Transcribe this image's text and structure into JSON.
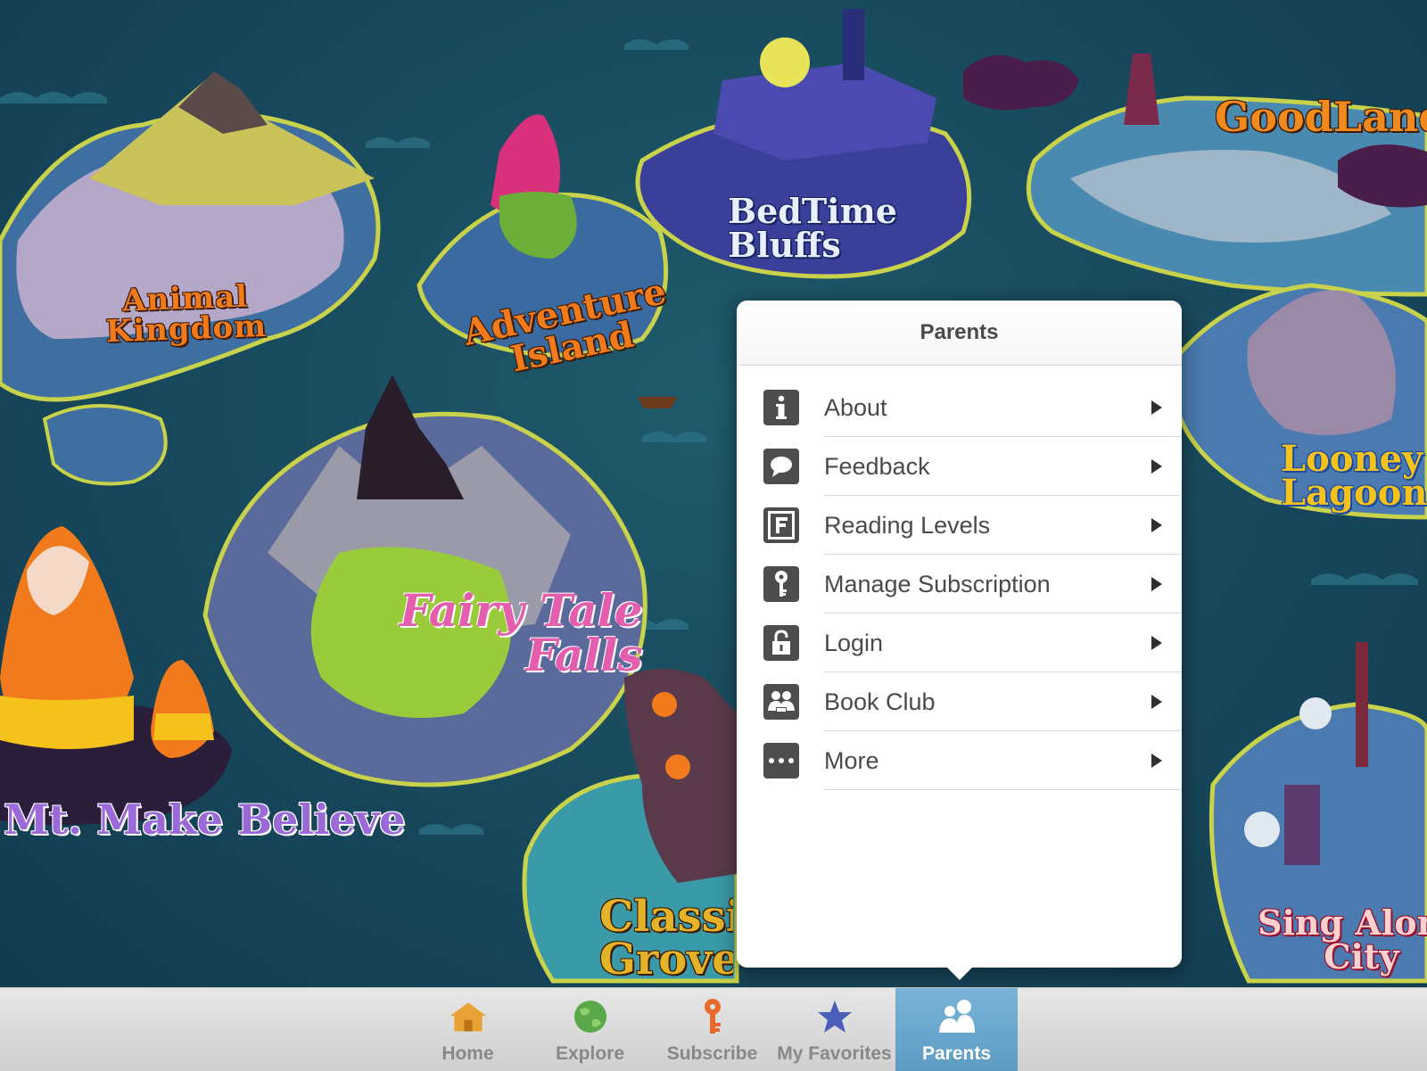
{
  "map": {
    "regions": {
      "animal_kingdom": "Animal\nKingdom",
      "adventure_island": "Adventure\nIsland",
      "bedtime_bluffs": "BedTime\nBluffs",
      "goodland": "GoodLand",
      "looney_lagoon": "Looney\nLagoon",
      "fairy_tale_falls": "Fairy Tale\nFalls",
      "mt_make_believe": "Mt. Make Believe",
      "classic_grove": "Classic\nGrove",
      "sing_along_city": "Sing Along\nCity"
    }
  },
  "popover": {
    "title": "Parents",
    "items": [
      {
        "label": "About",
        "icon": "info-icon"
      },
      {
        "label": "Feedback",
        "icon": "speech-bubble-icon"
      },
      {
        "label": "Reading Levels",
        "icon": "letter-f-icon"
      },
      {
        "label": "Manage Subscription",
        "icon": "key-icon"
      },
      {
        "label": "Login",
        "icon": "unlock-icon"
      },
      {
        "label": "Book Club",
        "icon": "group-icon"
      },
      {
        "label": "More",
        "icon": "more-dots-icon"
      }
    ]
  },
  "tabbar": {
    "tabs": [
      {
        "label": "Home",
        "icon": "home-icon",
        "color": "#e8a334"
      },
      {
        "label": "Explore",
        "icon": "globe-icon",
        "color": "#5aa84a"
      },
      {
        "label": "Subscribe",
        "icon": "key-icon",
        "color": "#e86a2a"
      },
      {
        "label": "My Favorites",
        "icon": "star-icon",
        "color": "#4c5fb8"
      },
      {
        "label": "Parents",
        "icon": "parents-icon",
        "color": "#ffffff",
        "active": true
      }
    ]
  },
  "colors": {
    "ocean": "#17465a",
    "active_tab": "#6aa8cf",
    "menu_icon_bg": "#4d4d4d"
  }
}
